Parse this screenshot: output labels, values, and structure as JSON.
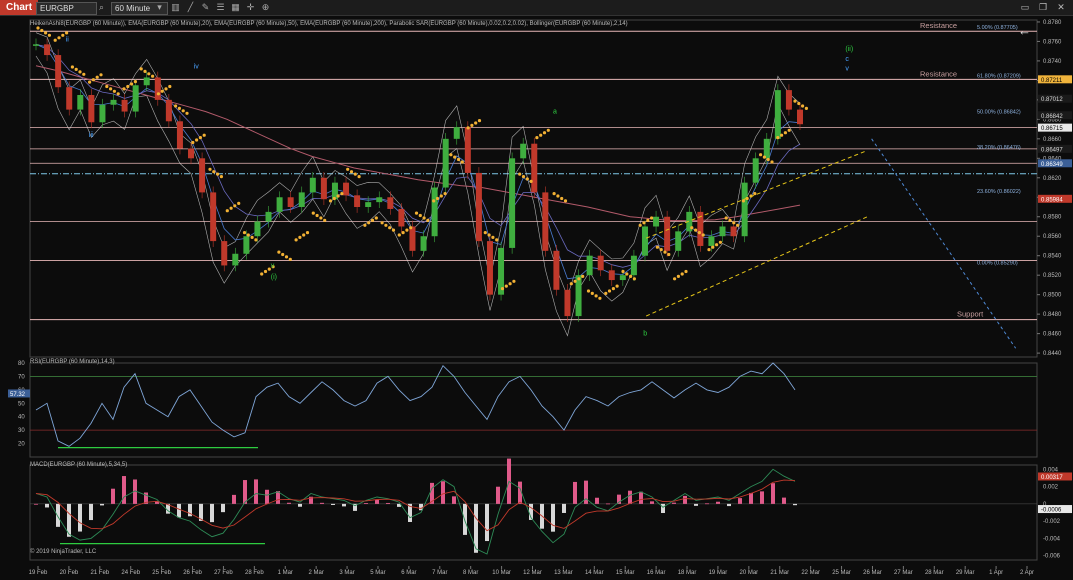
{
  "toolbar": {
    "chart_tab": "Chart",
    "symbol": "EURGBP",
    "timeframe": "60 Minute",
    "icons": [
      "search-icon",
      "chevron-down-icon",
      "bar-style-icon",
      "drawing-icon",
      "pencil-icon",
      "properties-icon",
      "layout-icon",
      "cursor-icon",
      "zoom-icon",
      "back-arrow-icon"
    ],
    "window_controls": [
      "maximize-icon",
      "restore-icon",
      "close-icon"
    ]
  },
  "indicators_label": "HeikenAshi8(EURGBP (60 Minute)), EMA(EURGBP (60 Minute),20), EMA(EURGBP (60 Minute),50), EMA(EURGBP (60 Minute),200), Parabolic SAR(EURGBP (60 Minute),0.02,0.2,0.02), Bollinger(EURGBP (60 Minute),2,14)",
  "rsi_label": "RSI(EURGBP (60 Minute),14,3)",
  "macd_label": "MACD(EURGBP (60 Minute),5,34,5)",
  "copyright": "© 2019 NinjaTrader, LLC",
  "colors": {
    "up": "#3fae3f",
    "down": "#c0392b",
    "sar": "#f2b134",
    "bb": "#d8d8d8",
    "ema20": "#4a7bd0",
    "ema50": "#6a6abf",
    "ema200": "#b25a6a",
    "hline": "#e7b7b7",
    "channel": "#e6c619",
    "proj": "#4f8ad6",
    "rsi": "#7fa6d8",
    "macd_pos": "#e05a8a"
  },
  "chart_data": [
    {
      "type": "line",
      "panel": "price",
      "x_ticks": [
        "19 Feb",
        "20 Feb",
        "21 Feb",
        "24 Feb",
        "25 Feb",
        "26 Feb",
        "27 Feb",
        "28 Feb",
        "1 Mar",
        "2 Mar",
        "3 Mar",
        "5 Mar",
        "6 Mar",
        "7 Mar",
        "8 Mar",
        "10 Mar",
        "12 Mar",
        "13 Mar",
        "14 Mar",
        "15 Mar",
        "16 Mar",
        "18 Mar",
        "19 Mar",
        "20 Mar",
        "21 Mar",
        "22 Mar",
        "25 Mar",
        "26 Mar",
        "27 Mar",
        "28 Mar",
        "29 Mar",
        "1 Apr",
        "2 Apr"
      ],
      "ylim": [
        0.8436,
        0.8782
      ],
      "y_ticks": [
        "0.8780",
        "0.8760",
        "0.8740",
        "0.8720",
        "0.8700",
        "0.8680",
        "0.8660",
        "0.8640",
        "0.8620",
        "0.8600",
        "0.8580",
        "0.8560",
        "0.8540",
        "0.8520",
        "0.8500",
        "0.8480",
        "0.8460",
        "0.8440"
      ],
      "series": [
        {
          "name": "price",
          "values": [
            0.8757,
            0.8746,
            0.8713,
            0.869,
            0.8705,
            0.8677,
            0.8695,
            0.87,
            0.8688,
            0.8715,
            0.8723,
            0.87,
            0.8678,
            0.865,
            0.864,
            0.8605,
            0.8555,
            0.853,
            0.8542,
            0.856,
            0.8575,
            0.8585,
            0.86,
            0.859,
            0.8605,
            0.862,
            0.8598,
            0.8615,
            0.8602,
            0.859,
            0.8595,
            0.86,
            0.8588,
            0.857,
            0.8545,
            0.856,
            0.861,
            0.866,
            0.8672,
            0.8625,
            0.8555,
            0.85,
            0.8548,
            0.864,
            0.8655,
            0.8605,
            0.8545,
            0.8505,
            0.8478,
            0.852,
            0.854,
            0.8525,
            0.8515,
            0.852,
            0.854,
            0.857,
            0.858,
            0.8545,
            0.8565,
            0.8585,
            0.855,
            0.856,
            0.857,
            0.856,
            0.8615,
            0.864,
            0.866,
            0.871,
            0.869,
            0.8675
          ]
        },
        {
          "name": "ema200",
          "values": [
            0.8735,
            0.873,
            0.8724,
            0.8718,
            0.8712,
            0.8706,
            0.87,
            0.8694,
            0.8688,
            0.868,
            0.867,
            0.866,
            0.865,
            0.8642,
            0.8636,
            0.863,
            0.8626,
            0.8622,
            0.8618,
            0.8615,
            0.8612,
            0.861,
            0.8606,
            0.8602,
            0.8598,
            0.8594,
            0.859,
            0.8585,
            0.858,
            0.8578,
            0.8576,
            0.8576,
            0.8577,
            0.858,
            0.8584,
            0.8588,
            0.8592
          ]
        },
        {
          "name": "parabolic_sar",
          "values": [
            0.877,
            0.8765,
            0.873,
            0.8722,
            0.871,
            0.8715,
            0.8728,
            0.871,
            0.869,
            0.866,
            0.8625,
            0.859,
            0.856,
            0.8525,
            0.854,
            0.856,
            0.858,
            0.86,
            0.8625,
            0.8575,
            0.857,
            0.8565,
            0.858,
            0.86,
            0.864,
            0.8675,
            0.856,
            0.851,
            0.862,
            0.8665,
            0.86,
            0.8515,
            0.85,
            0.8505,
            0.852,
            0.8575,
            0.8545,
            0.852,
            0.8565,
            0.855,
            0.8575,
            0.86,
            0.864,
            0.8665,
            0.8695
          ]
        }
      ],
      "resistance": [
        0.87705,
        0.87211
      ],
      "support": [
        0.84744
      ],
      "other_lines": [
        0.86715,
        0.86497,
        0.86349
      ],
      "dashdot_line": 0.86242,
      "fib_levels": [
        {
          "label": "5.00% (0.87705)",
          "value": 0.87705
        },
        {
          "label": "61.80% (0.87209)",
          "value": 0.87209
        },
        {
          "label": "50.00% (0.86842)",
          "value": 0.86842
        },
        {
          "label": "38.20% (0.86476)",
          "value": 0.86476
        },
        {
          "label": "23.60% (0.86022)",
          "value": 0.86022
        },
        {
          "label": "0.00% (0.85290)",
          "value": 0.8529
        }
      ],
      "price_tags": [
        {
          "label": "0.87211",
          "value": 0.87211,
          "bg": "#f0b43c",
          "fg": "#000"
        },
        {
          "label": "0.87012",
          "value": 0.87012,
          "bg": "#1a1a1a",
          "fg": "#ddd"
        },
        {
          "label": "0.86842",
          "value": 0.86842,
          "bg": "#1a1a1a",
          "fg": "#ddd"
        },
        {
          "label": "0.86715",
          "value": 0.86715,
          "bg": "#e8e8e8",
          "fg": "#000"
        },
        {
          "label": "0.86497",
          "value": 0.86497,
          "bg": "#1a1a1a",
          "fg": "#ddd"
        },
        {
          "label": "0.86349",
          "value": 0.86349,
          "bg": "#3b5f97",
          "fg": "#fff"
        },
        {
          "label": "0.85984",
          "value": 0.85984,
          "bg": "#c0392b",
          "fg": "#fff"
        }
      ],
      "annotations": [
        {
          "text": "Resistance",
          "x": 66,
          "y": 0.87705
        },
        {
          "text": "Resistance",
          "x": 66,
          "y": 0.87211
        },
        {
          "text": "Support",
          "x": 66,
          "y": 0.84744
        },
        {
          "text": "(i)",
          "x": 16,
          "y": 0.8516,
          "color": "#2ecc40"
        },
        {
          "text": "v",
          "x": 16,
          "y": 0.8528,
          "color": "#2ecc40"
        },
        {
          "text": "(ii)",
          "x": 55.5,
          "y": 0.875,
          "color": "#2ecc40"
        },
        {
          "text": "a",
          "x": 35.4,
          "y": 0.8686,
          "color": "#2ecc40"
        },
        {
          "text": "b",
          "x": 41.6,
          "y": 0.8458,
          "color": "#2ecc40"
        },
        {
          "text": "c",
          "x": 55.5,
          "y": 0.874,
          "color": "#4aa3ff"
        },
        {
          "text": "ii",
          "x": 1.9,
          "y": 0.876,
          "color": "#4aa3ff"
        },
        {
          "text": "iii",
          "x": 3.5,
          "y": 0.8662,
          "color": "#4aa3ff"
        },
        {
          "text": "iv",
          "x": 10.7,
          "y": 0.8732,
          "color": "#4aa3ff"
        },
        {
          "text": "v",
          "x": 55.5,
          "y": 0.873,
          "color": "#4aa3ff"
        }
      ],
      "channel": {
        "upper": [
          [
            41.8,
            0.8558
          ],
          [
            57.0,
            0.8648
          ]
        ],
        "lower": [
          [
            41.8,
            0.8478
          ],
          [
            57.0,
            0.858
          ]
        ]
      },
      "projection": [
        [
          57.3,
          0.866
        ],
        [
          67.2,
          0.8445
        ]
      ]
    },
    {
      "type": "line",
      "panel": "rsi",
      "ylim": [
        10,
        80
      ],
      "y_ticks": [
        "80",
        "70",
        "60",
        "50",
        "40",
        "30",
        "20"
      ],
      "levels": [
        70,
        30
      ],
      "current_value_label": "57.32",
      "series": [
        {
          "name": "RSI",
          "values": [
            45,
            50,
            22,
            18,
            24,
            35,
            50,
            38,
            62,
            72,
            50,
            45,
            40,
            55,
            60,
            48,
            36,
            30,
            25,
            28,
            55,
            62,
            65,
            55,
            50,
            58,
            66,
            60,
            52,
            48,
            52,
            65,
            70,
            60,
            52,
            55,
            62,
            78,
            70,
            58,
            48,
            38,
            55,
            66,
            70,
            60,
            48,
            40,
            30,
            45,
            55,
            52,
            48,
            55,
            58,
            60,
            66,
            60,
            54,
            60,
            65,
            60,
            58,
            62,
            70,
            74,
            72,
            80,
            72,
            60
          ]
        }
      ]
    },
    {
      "type": "line",
      "panel": "macd",
      "ylim": [
        -0.0065,
        0.0045
      ],
      "y_ticks": [
        "0.004",
        "0.002",
        "0",
        "-0.002",
        "-0.004",
        "-0.006"
      ],
      "value_tags": [
        "0.00317",
        "-0.0006"
      ],
      "series": [
        {
          "name": "MACD",
          "values": [
            0.0012,
            0.0008,
            -0.0015,
            -0.0035,
            -0.0042,
            -0.004,
            -0.003,
            -0.0012,
            0.0008,
            0.0015,
            0.001,
            0.0005,
            -0.0008,
            -0.0016,
            -0.002,
            -0.003,
            -0.0038,
            -0.0034,
            -0.0018,
            0.0002,
            0.0012,
            0.001,
            0.0014,
            0.0006,
            0.0002,
            0.0012,
            0.0008,
            0.0006,
            0.0004,
            -0.0002,
            0.0004,
            0.0008,
            0.0006,
            0.0002,
            -0.0016,
            -0.001,
            0.0018,
            0.0028,
            0.002,
            -0.002,
            -0.0052,
            -0.0058,
            -0.0012,
            0.0026,
            0.0018,
            -0.0016,
            -0.0032,
            -0.0045,
            -0.0035,
            -0.0004,
            0.0006,
            -0.0004,
            -0.0008,
            0.0002,
            0.001,
            0.0014,
            0.0008,
            -0.0004,
            0.0004,
            0.0012,
            0.0004,
            0.0006,
            0.0008,
            0.0004,
            0.0012,
            0.002,
            0.0026,
            0.004,
            0.0032,
            0.0026
          ]
        }
      ]
    }
  ]
}
